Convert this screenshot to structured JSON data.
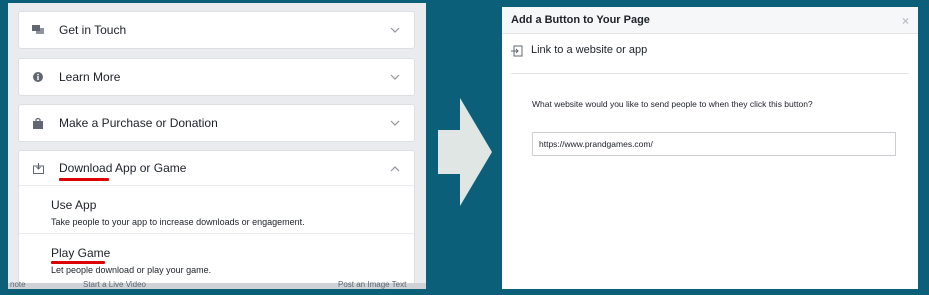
{
  "left": {
    "items": [
      {
        "label": "Get in Touch",
        "icon": "chat-icon",
        "expanded": false
      },
      {
        "label": "Learn More",
        "icon": "info-icon",
        "expanded": false
      },
      {
        "label": "Make a Purchase or Donation",
        "icon": "shopping-bag-icon",
        "expanded": false
      },
      {
        "label": "Download App or Game",
        "icon": "download-icon",
        "expanded": true
      }
    ],
    "sub_items": [
      {
        "title": "Use App",
        "desc": "Take people to your app to increase downloads or engagement."
      },
      {
        "title": "Play Game",
        "desc": "Let people download or play your game."
      }
    ],
    "bottom_cut": [
      "note",
      "Start a Live Video",
      "Post an Image Text"
    ]
  },
  "dialog": {
    "title": "Add a Button to Your Page",
    "close": "×",
    "link_label": "Link to a website or app",
    "question": "What website would you like to send people to when they click this button?",
    "input_value": "https://www.prandgames.com/"
  },
  "colors": {
    "background": "#0b5f78",
    "highlight": "#dd0000",
    "arrow": "#dfe6e4"
  }
}
